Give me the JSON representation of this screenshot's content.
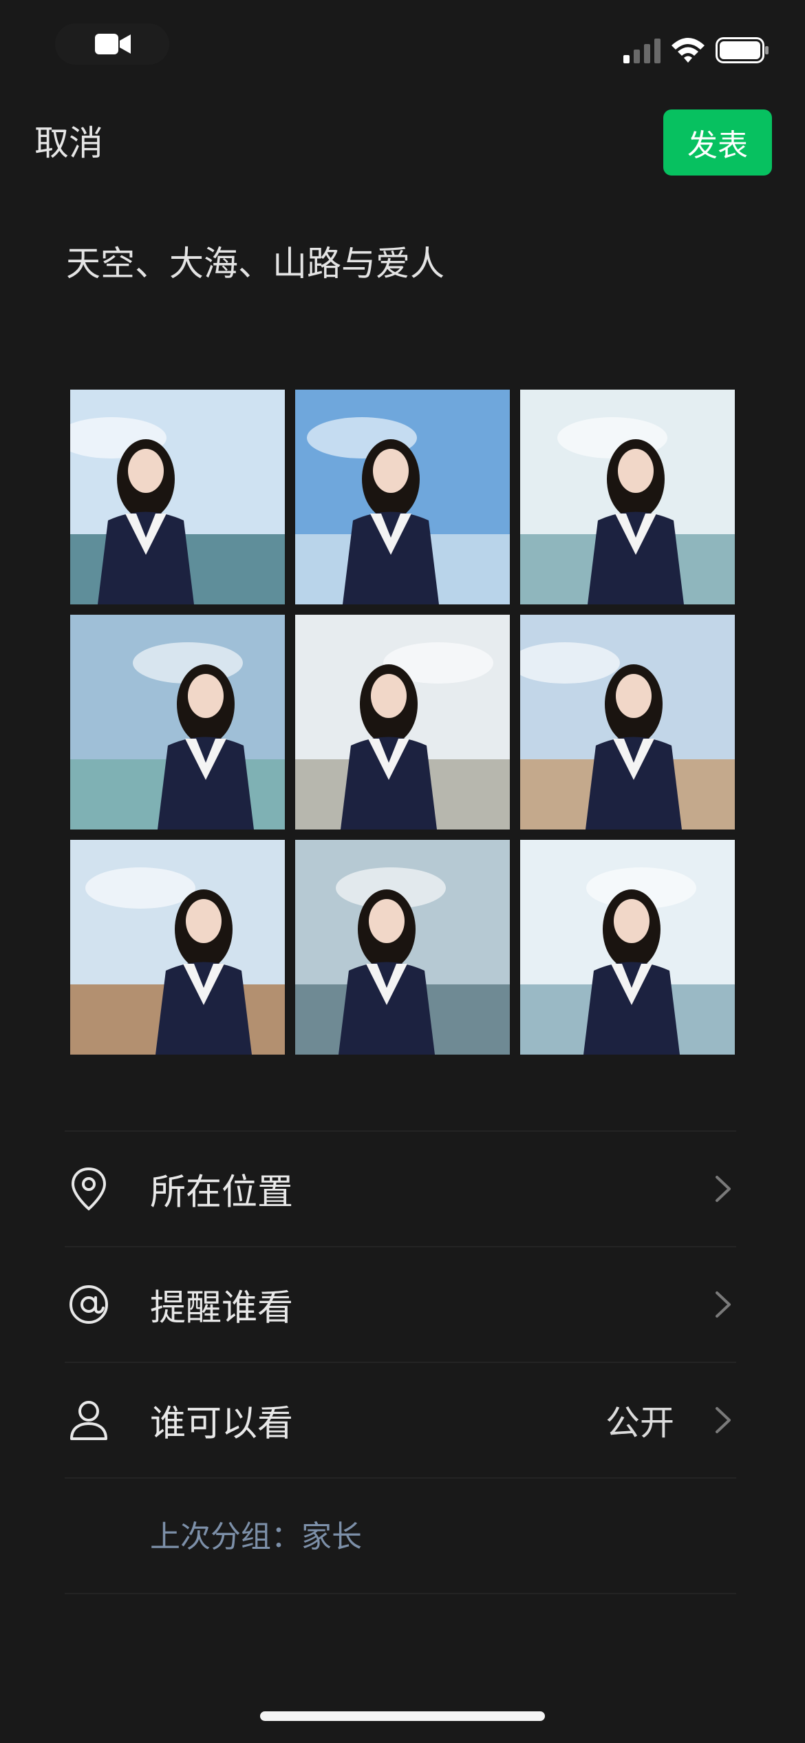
{
  "nav": {
    "cancel_label": "取消",
    "publish_label": "发表"
  },
  "post": {
    "text": "天空、大海、山路与爱人"
  },
  "photos": [
    {
      "name": "photo-1",
      "sky": "#cfe2f2",
      "ground": "#5f8e9a"
    },
    {
      "name": "photo-2",
      "sky": "#6fa7dc",
      "ground": "#b9d4ea"
    },
    {
      "name": "photo-3",
      "sky": "#e4eef2",
      "ground": "#8fb6bd"
    },
    {
      "name": "photo-4",
      "sky": "#9fbfd7",
      "ground": "#7fb1b4"
    },
    {
      "name": "photo-5",
      "sky": "#e7ecef",
      "ground": "#b7b7ae"
    },
    {
      "name": "photo-6",
      "sky": "#c2d6e8",
      "ground": "#c4a98c"
    },
    {
      "name": "photo-7",
      "sky": "#d2e2ef",
      "ground": "#b39070"
    },
    {
      "name": "photo-8",
      "sky": "#b6c9d3",
      "ground": "#6f8a94"
    },
    {
      "name": "photo-9",
      "sky": "#e7f0f5",
      "ground": "#9ab9c5"
    }
  ],
  "options": {
    "location_label": "所在位置",
    "mention_label": "提醒谁看",
    "visibility_label": "谁可以看",
    "visibility_value": "公开",
    "last_group_text": "上次分组：家长"
  },
  "colors": {
    "background": "#191919",
    "accent": "#07c160",
    "secondary_text": "#7d90a9"
  },
  "icons": {
    "location": "location-pin-icon",
    "mention": "at-sign-icon",
    "visibility": "person-icon",
    "chevron": "chevron-right-icon"
  }
}
